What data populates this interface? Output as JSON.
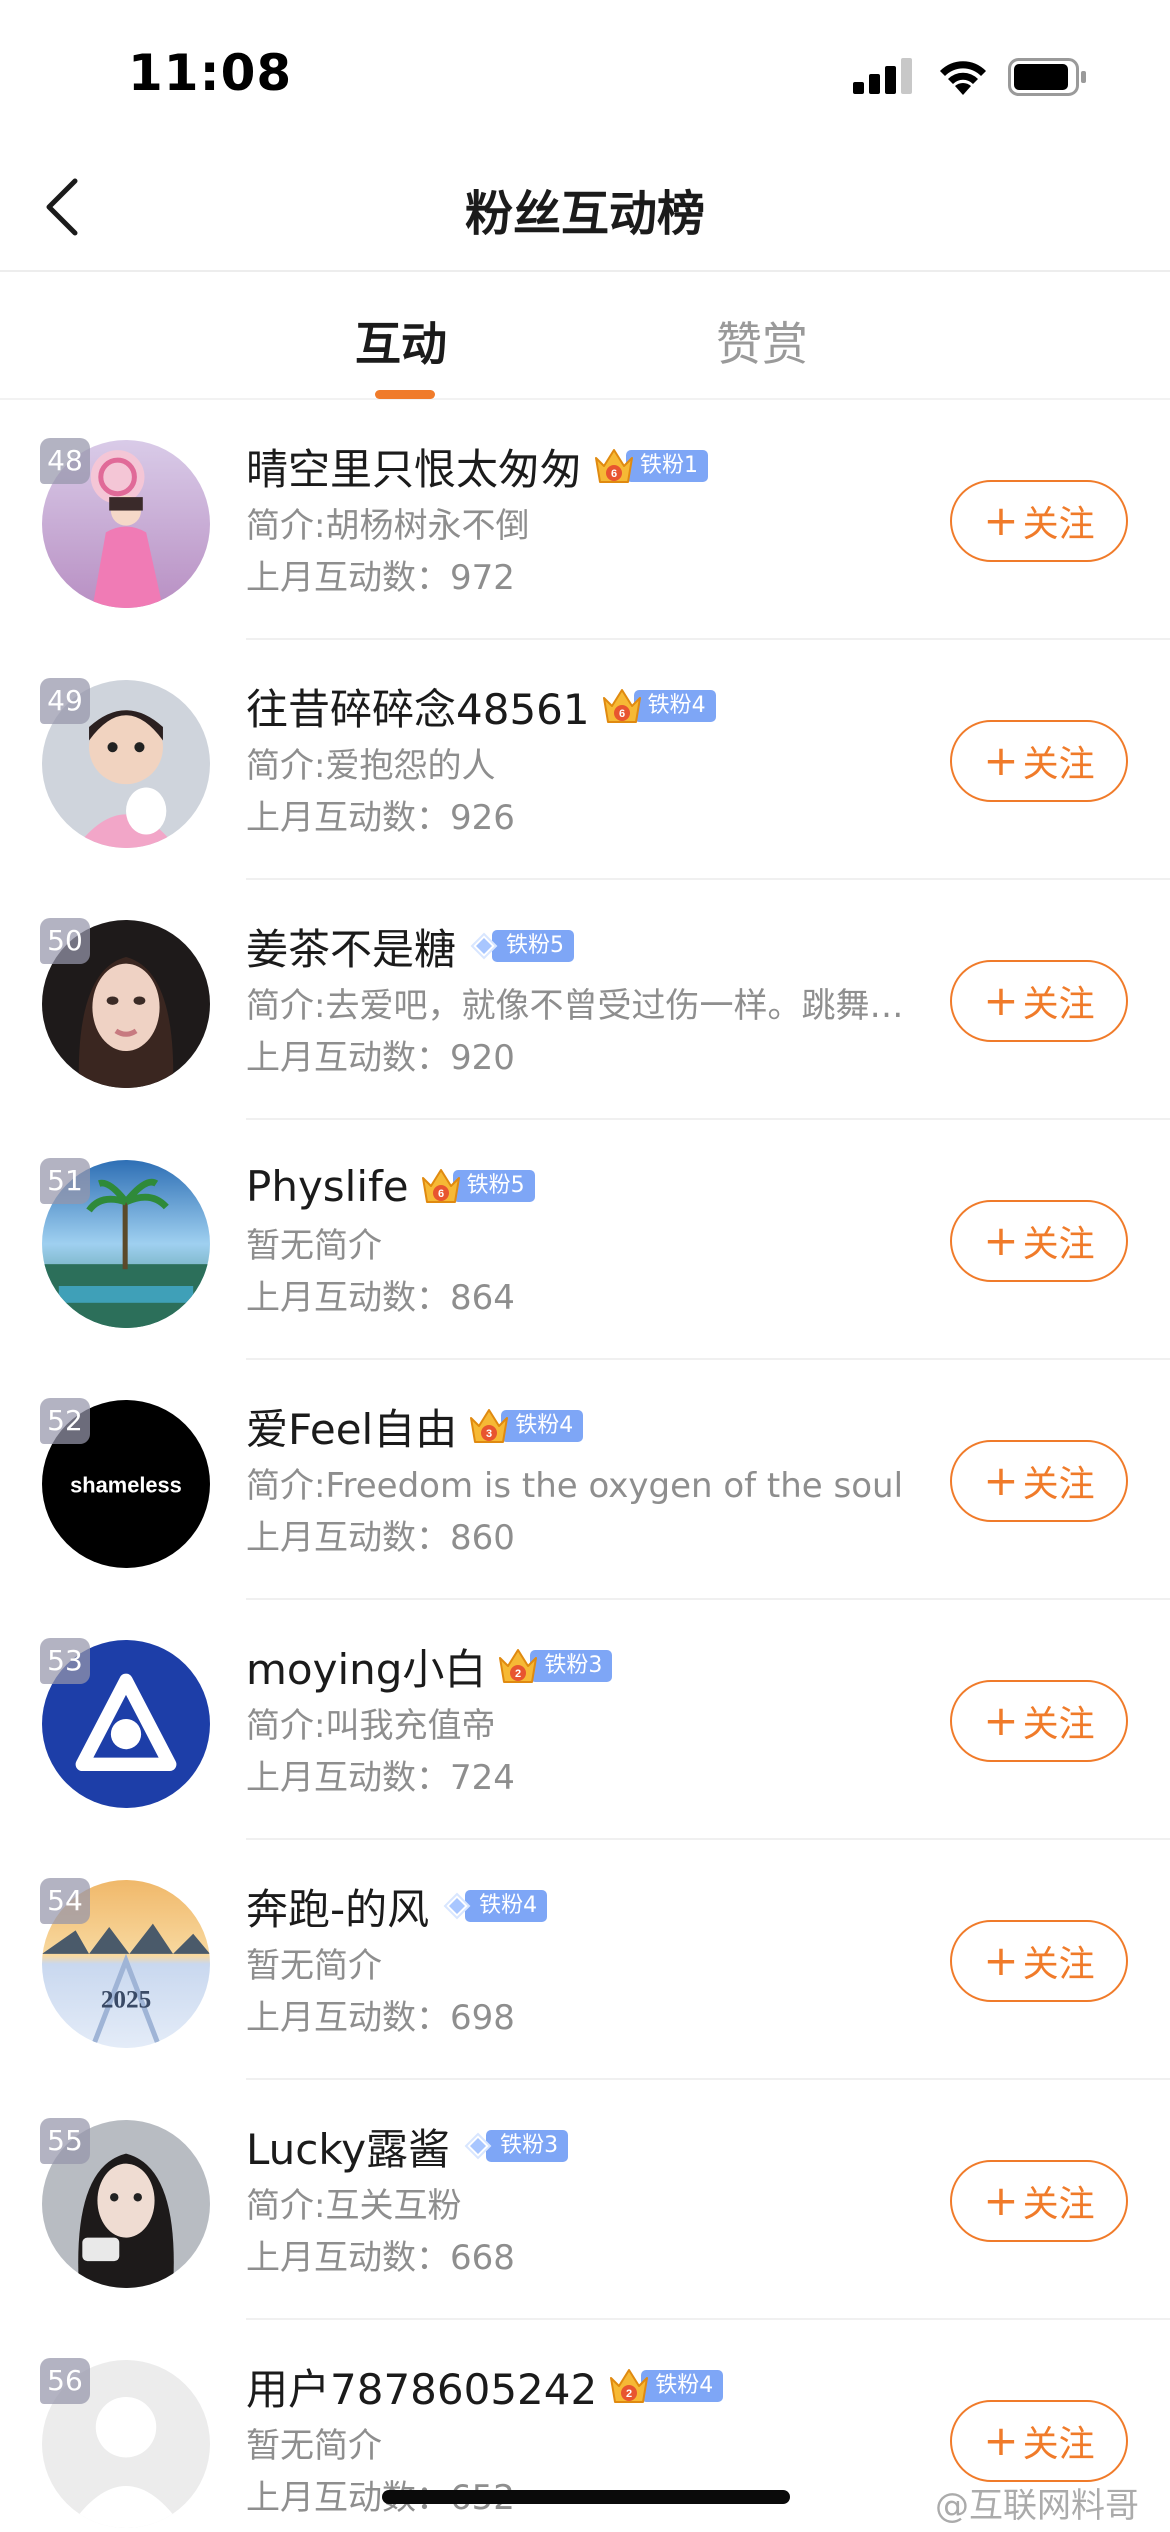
{
  "status_bar": {
    "time": "11:08"
  },
  "nav": {
    "title": "粉丝互动榜"
  },
  "tabs": [
    {
      "label": "互动",
      "active": true
    },
    {
      "label": "赞赏",
      "active": false
    }
  ],
  "follow_label": "关注",
  "colors": {
    "accent": "#f07b2a",
    "fan_badge": "#7ea6f6",
    "rank_badge": "#9696aa"
  },
  "rows": [
    {
      "rank": "48",
      "name": "晴空里只恨太匆匆",
      "badge_icon": "crown-icon",
      "crown_level": "6",
      "fan_level": "铁粉1",
      "bio": "简介:胡杨树永不倒",
      "count": "上月互动数：972",
      "avatar": "pink-costume-girl"
    },
    {
      "rank": "49",
      "name": "往昔碎碎念48561",
      "badge_icon": "crown-icon",
      "crown_level": "6",
      "fan_level": "铁粉4",
      "bio": "简介:爱抱怨的人",
      "count": "上月互动数：926",
      "avatar": "little-girl-photo"
    },
    {
      "rank": "50",
      "name": "姜茶不是糖",
      "badge_icon": "diamond-icon",
      "crown_level": "",
      "fan_level": "铁粉5",
      "bio": "简介:去爱吧，就像不曾受过伤一样。跳舞吧，像没有人欣赏一样",
      "count": "上月互动数：920",
      "avatar": "woman-portrait"
    },
    {
      "rank": "51",
      "name": "Physlife",
      "badge_icon": "crown-icon",
      "crown_level": "6",
      "fan_level": "铁粉5",
      "bio": "暂无简介",
      "count": "上月互动数：864",
      "avatar": "tropical-resort"
    },
    {
      "rank": "52",
      "name": "爱Feel自由",
      "badge_icon": "crown-icon",
      "crown_level": "3",
      "fan_level": "铁粉4",
      "bio": "简介:Freedom is the oxygen of the soul",
      "count": "上月互动数：860",
      "avatar": "shameless-logo",
      "avatar_text": "shameless"
    },
    {
      "rank": "53",
      "name": "moying小白",
      "badge_icon": "crown-icon",
      "crown_level": "2",
      "fan_level": "铁粉3",
      "bio": "简介:叫我充值帝",
      "count": "上月互动数：724",
      "avatar": "blue-triangle-logo"
    },
    {
      "rank": "54",
      "name": "奔跑-的风",
      "badge_icon": "diamond-icon",
      "crown_level": "",
      "fan_level": "铁粉4",
      "bio": "暂无简介",
      "count": "上月互动数：698",
      "avatar": "snow-sunset-2025",
      "avatar_text": "2025"
    },
    {
      "rank": "55",
      "name": "Lucky露酱",
      "badge_icon": "diamond-icon",
      "crown_level": "",
      "fan_level": "铁粉3",
      "bio": "简介:互关互粉",
      "count": "上月互动数：668",
      "avatar": "girl-selfie"
    },
    {
      "rank": "56",
      "name": "用户7878605242",
      "badge_icon": "crown-icon",
      "crown_level": "2",
      "fan_level": "铁粉4",
      "bio": "暂无简介",
      "count": "上月互动数：652",
      "avatar": "default-avatar"
    }
  ],
  "watermark": "@互联网料哥"
}
